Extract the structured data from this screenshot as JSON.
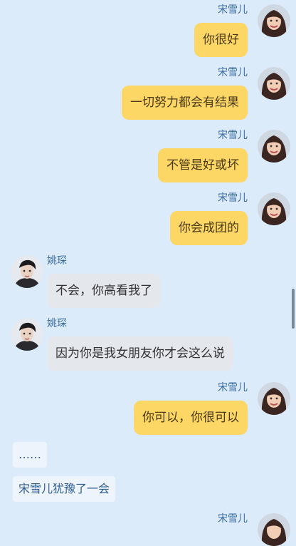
{
  "participants": {
    "right": {
      "name": "宋雪儿",
      "avatar": "girl-avatar"
    },
    "left": {
      "name": "姚琛",
      "avatar": "boy-avatar"
    }
  },
  "messages": [
    {
      "side": "right",
      "name": "宋雪儿",
      "text": "你很好"
    },
    {
      "side": "right",
      "name": "宋雪儿",
      "text": "一切努力都会有结果"
    },
    {
      "side": "right",
      "name": "宋雪儿",
      "text": "不管是好或坏"
    },
    {
      "side": "right",
      "name": "宋雪儿",
      "text": "你会成团的"
    },
    {
      "side": "left",
      "name": "姚琛",
      "text": "不会，你高看我了"
    },
    {
      "side": "left",
      "name": "姚琛",
      "text": "因为你是我女朋友你才会这么说"
    },
    {
      "side": "right",
      "name": "宋雪儿",
      "text": "你可以，你很可以"
    }
  ],
  "narration": [
    {
      "text": "……"
    },
    {
      "text": "宋雪儿犹豫了一会"
    }
  ],
  "partial_message": {
    "side": "right",
    "name": "宋雪儿"
  },
  "colors": {
    "background": "#dcebfa",
    "right_bubble": "#fdd766",
    "left_bubble": "#e4e7ec",
    "name_text": "#3a6d9e",
    "narration_bg": "#eef4fb"
  }
}
